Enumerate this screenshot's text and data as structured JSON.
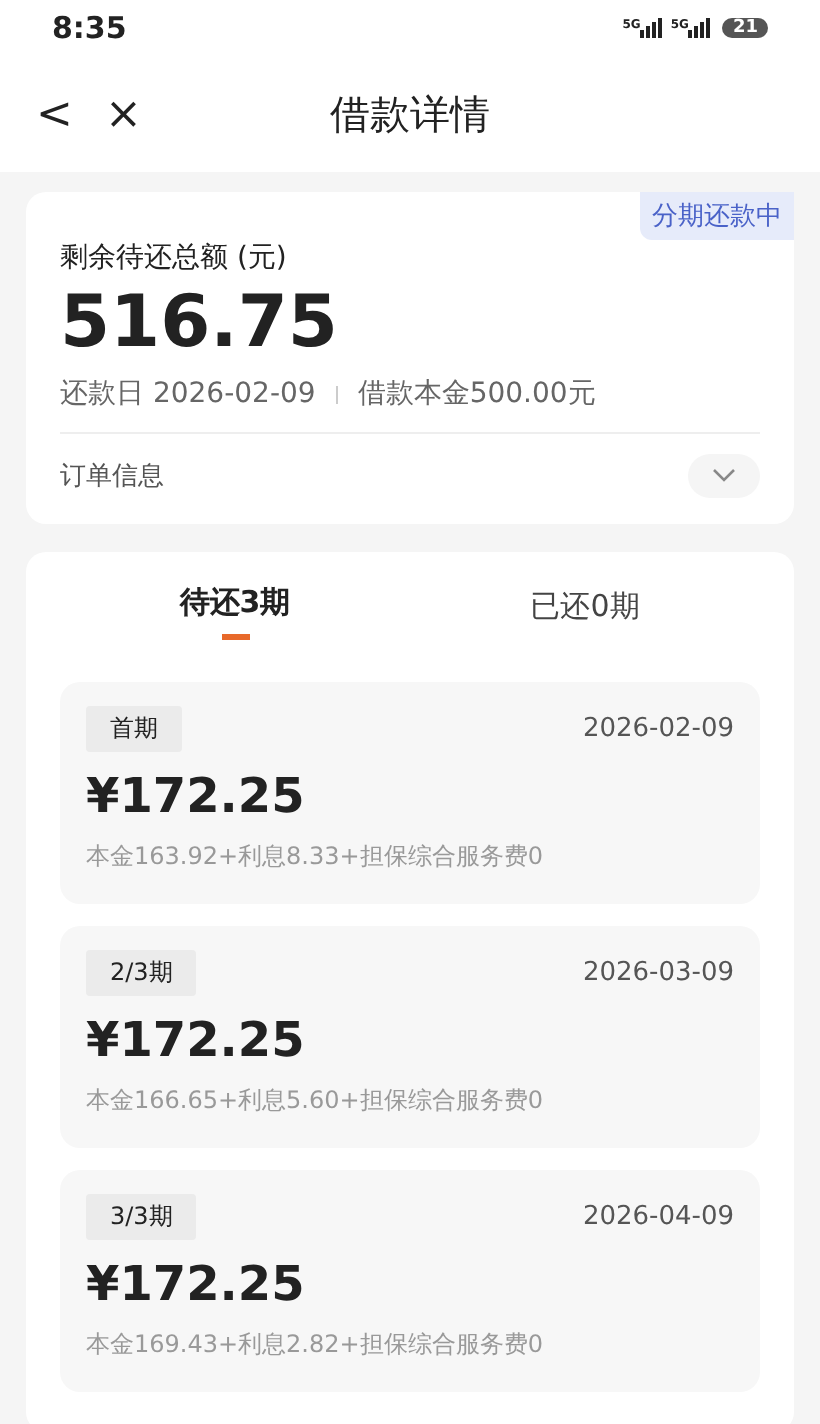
{
  "status_bar": {
    "time": "8:35",
    "network_1": "5G",
    "network_2": "5G",
    "battery": "21"
  },
  "header": {
    "back": "<",
    "close": "×",
    "title": "借款详情"
  },
  "summary": {
    "badge": "分期还款中",
    "label": "剩余待还总额 (元)",
    "amount": "516.75",
    "due_date": "还款日 2026-02-09",
    "principal": "借款本金500.00元",
    "order_info": "订单信息",
    "expanded": false
  },
  "tabs": [
    {
      "label": "待还3期",
      "selected": true
    },
    {
      "label": "已还0期",
      "selected": false
    }
  ],
  "installments": [
    {
      "tag": "首期",
      "date": "2026-02-09",
      "amount": "¥172.25",
      "detail": "本金163.92+利息8.33+担保综合服务费0"
    },
    {
      "tag": "2/3期",
      "date": "2026-03-09",
      "amount": "¥172.25",
      "detail": "本金166.65+利息5.60+担保综合服务费0"
    },
    {
      "tag": "3/3期",
      "date": "2026-04-09",
      "amount": "¥172.25",
      "detail": "本金169.43+利息2.82+担保综合服务费0"
    }
  ]
}
